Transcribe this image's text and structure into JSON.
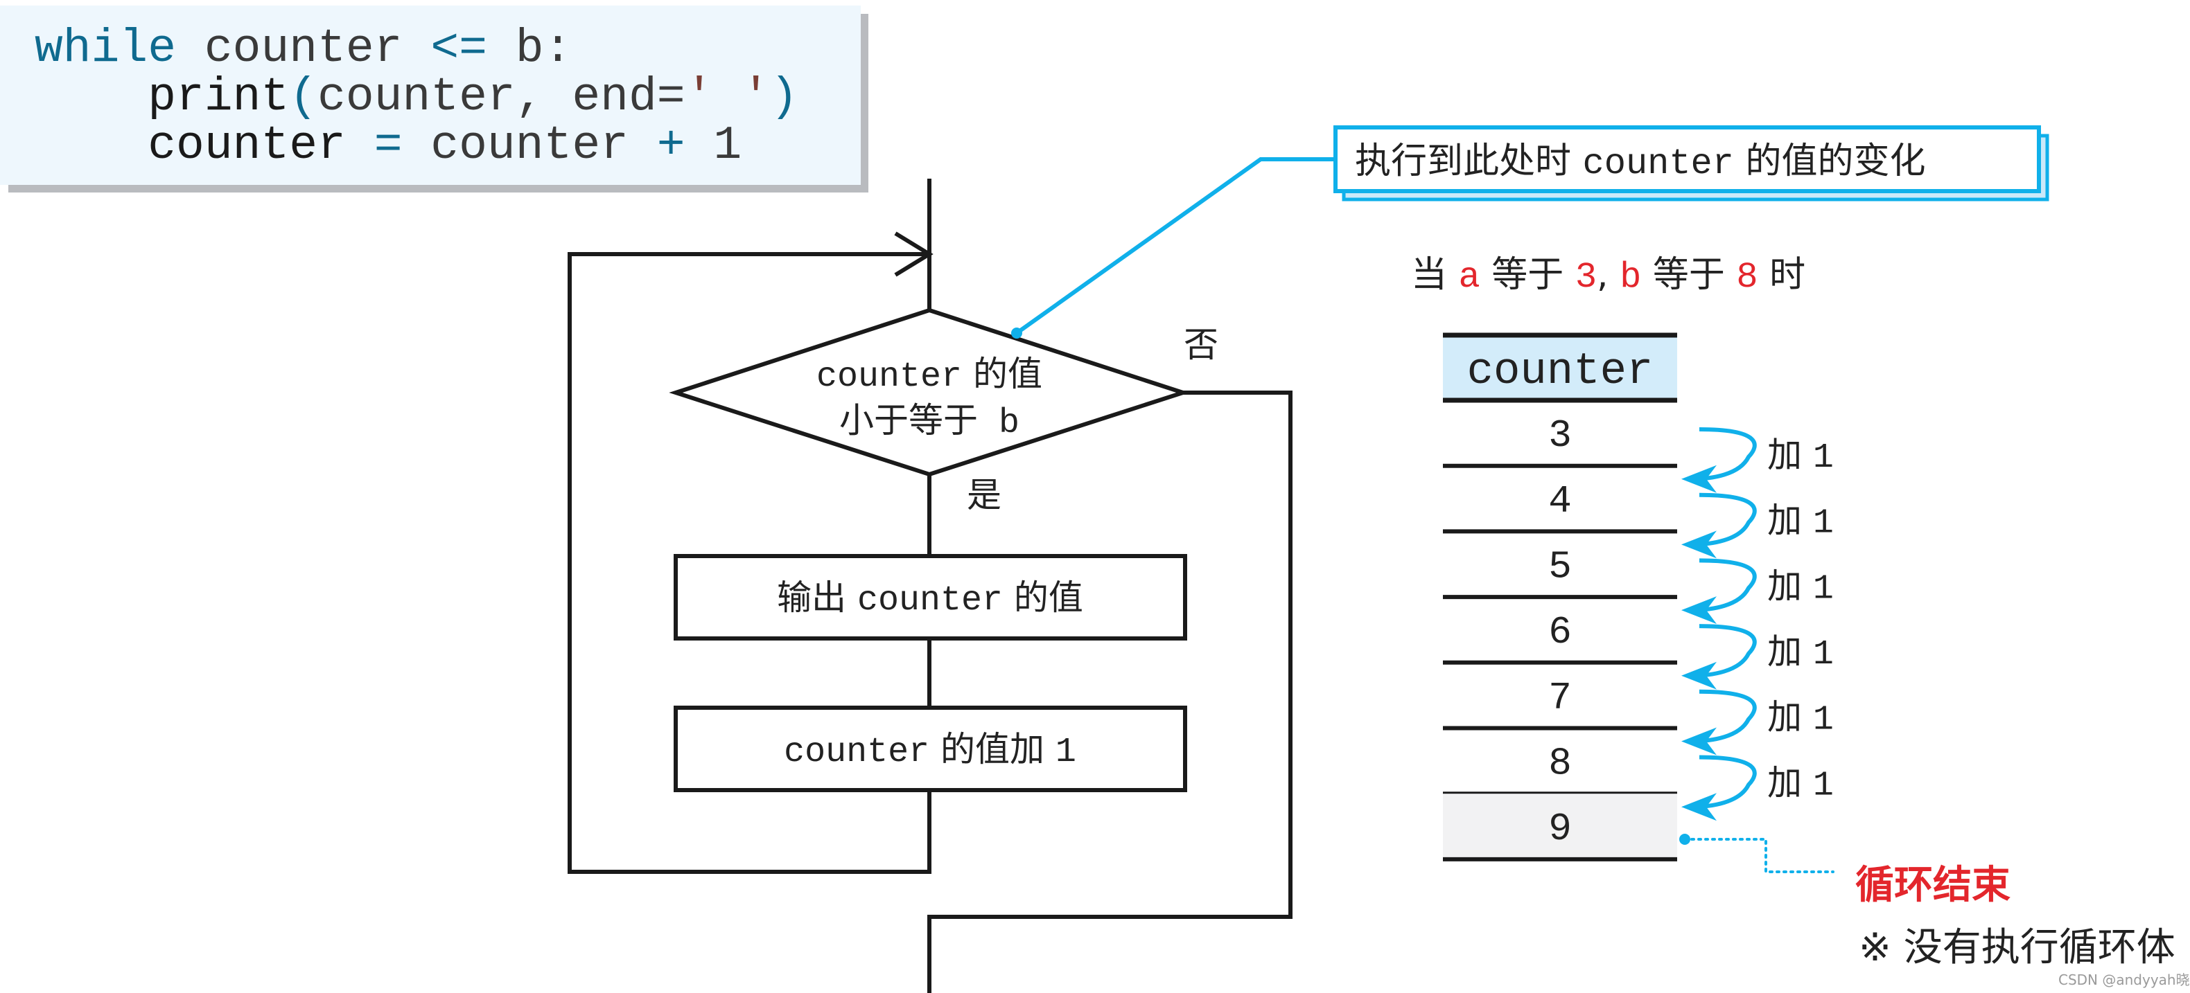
{
  "code": {
    "lines": [
      [
        {
          "t": "while",
          "c": "kw"
        },
        {
          "t": " counter ",
          "c": "plain"
        },
        {
          "t": "<=",
          "c": "kw"
        },
        {
          "t": " b:",
          "c": "plain"
        }
      ],
      [
        {
          "t": "    print",
          "c": "plain"
        },
        {
          "t": "(",
          "c": "kw"
        },
        {
          "t": "counter, end=",
          "c": "plain"
        },
        {
          "t": "'",
          "c": "str"
        },
        {
          "t": " ",
          "c": "plain"
        },
        {
          "t": "'",
          "c": "str"
        },
        {
          "t": ")",
          "c": "kw"
        }
      ],
      [
        {
          "t": "    counter ",
          "c": "plain"
        },
        {
          "t": "=",
          "c": "kw"
        },
        {
          "t": " counter ",
          "c": "plain"
        },
        {
          "t": "+",
          "c": "kw"
        },
        {
          "t": " 1",
          "c": "plain"
        }
      ]
    ]
  },
  "flowchart": {
    "decision": {
      "line1_code": "counter",
      "line1_cn": " 的值",
      "line2_cn": "小于等于",
      "line2_code": " b"
    },
    "yes_label": "是",
    "no_label": "否",
    "process1": {
      "cn1": "输出 ",
      "code": "counter",
      "cn2": " 的值"
    },
    "process2": {
      "code": "counter",
      "cn": " 的值加 ",
      "num": "1"
    }
  },
  "callout": {
    "pre": "执行到此处时 ",
    "code": "counter",
    "post": " 的值的变化"
  },
  "condition": {
    "parts": [
      {
        "t": "当 ",
        "c": "plain"
      },
      {
        "t": "a",
        "c": "red"
      },
      {
        "t": " 等于 ",
        "c": "plain"
      },
      {
        "t": "3",
        "c": "red"
      },
      {
        "t": ", ",
        "c": "plain"
      },
      {
        "t": "b",
        "c": "red"
      },
      {
        "t": " 等于 ",
        "c": "plain"
      },
      {
        "t": "8",
        "c": "red"
      },
      {
        "t": " 时",
        "c": "plain"
      }
    ]
  },
  "table": {
    "header": "counter",
    "values": [
      "3",
      "4",
      "5",
      "6",
      "7",
      "8",
      "9"
    ],
    "step_label_cn": "加",
    "step_label_num": "1",
    "final_index": 6
  },
  "loop_end": {
    "title": "循环结束",
    "note": "※ 没有执行循环体"
  },
  "watermark": "CSDN @andyyah晓波",
  "colors": {
    "keyword": "#0f6a8f",
    "string": "#7a3e35",
    "accent_blue": "#10b0ea",
    "highlight_red": "#e3262c",
    "code_bg": "#eef7fd",
    "header_bg": "#d3ecfa",
    "final_row_bg": "#f2f2f3"
  }
}
